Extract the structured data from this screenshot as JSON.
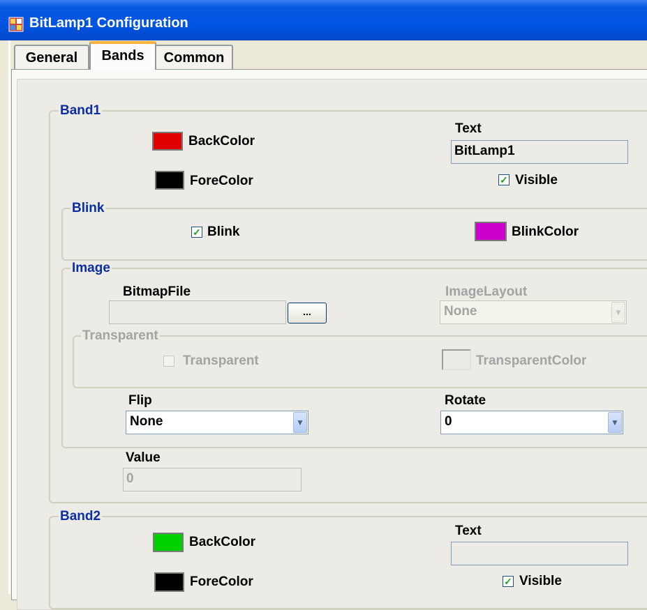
{
  "window": {
    "title": "BitLamp1 Configuration"
  },
  "tabs": [
    {
      "label": "General",
      "active": false
    },
    {
      "label": "Bands",
      "active": true
    },
    {
      "label": "Common",
      "active": false
    }
  ],
  "band1": {
    "title": "Band1",
    "backcolor_label": "BackColor",
    "backcolor": "#e00000",
    "forecolor_label": "ForeColor",
    "forecolor": "#000000",
    "text_label": "Text",
    "text_value": "BitLamp1",
    "visible_label": "Visible",
    "visible_checked": true,
    "check_mark": "✓",
    "blink": {
      "title": "Blink",
      "blink_label": "Blink",
      "blink_checked": true,
      "blinkcolor_label": "BlinkColor",
      "blinkcolor": "#cc00cc"
    },
    "image": {
      "title": "Image",
      "bitmapfile_label": "BitmapFile",
      "bitmapfile_value": "",
      "browse_label": "...",
      "imagelayout_label": "ImageLayout",
      "imagelayout_value": "None",
      "transparent_group_title": "Transparent",
      "transparent_label": "Transparent",
      "transparent_checked": false,
      "transparentcolor_label": "TransparentColor",
      "flip_label": "Flip",
      "flip_value": "None",
      "rotate_label": "Rotate",
      "rotate_value": "0"
    },
    "value_label": "Value",
    "value_value": "0"
  },
  "band2": {
    "title": "Band2",
    "backcolor_label": "BackColor",
    "backcolor": "#00d000",
    "forecolor_label": "ForeColor",
    "forecolor": "#000000",
    "text_label": "Text",
    "text_value": "",
    "visible_label": "Visible",
    "visible_checked": true,
    "check_mark": "✓"
  },
  "icons": {
    "dropdown": "chevron-down-icon",
    "app": "app-icon"
  }
}
